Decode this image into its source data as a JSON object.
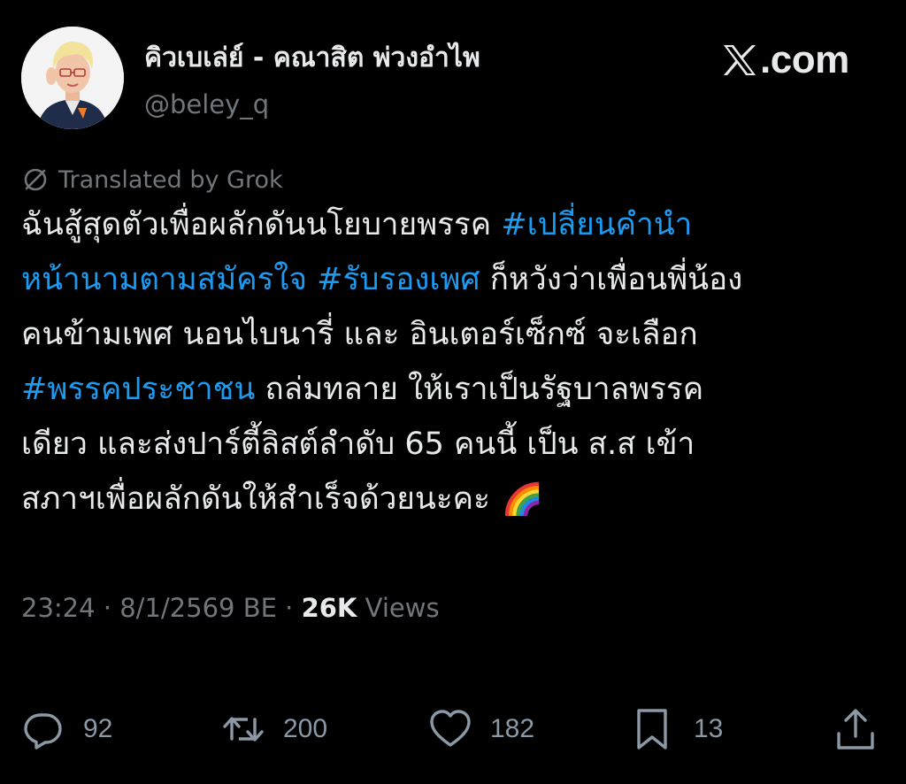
{
  "author": {
    "display_name": "คิวเบเล่ย์ - คณาสิต พ่วงอำไพ",
    "handle": "@beley_q",
    "avatar_icon": "profile-photo"
  },
  "brand": {
    "site": ".com",
    "logo_icon": "x-logo-icon"
  },
  "translation": {
    "label": "Translated by Grok",
    "icon": "translate-icon"
  },
  "tweet": {
    "lines": [
      [
        {
          "text": "ฉันสู้สุดตัวเพื่อผลักดันนโยบายพรรค ",
          "type": "text"
        },
        {
          "text": "#เปลี่ยนคำนำ",
          "type": "hashtag"
        }
      ],
      [
        {
          "text": "หน้านามตามสมัครใจ",
          "type": "hashtag"
        },
        {
          "text": " ",
          "type": "text"
        },
        {
          "text": "#รับรองเพศ",
          "type": "hashtag"
        },
        {
          "text": " ก็หวังว่าเพื่อนพี่น้อง",
          "type": "text"
        }
      ],
      [
        {
          "text": "คนข้ามเพศ  นอนไบนารี่ และ อินเตอร์เซ็กซ์ จะเลือก",
          "type": "text"
        }
      ],
      [
        {
          "text": "#พรรคประชาชน",
          "type": "hashtag"
        },
        {
          "text": " ถล่มทลาย ให้เราเป็นรัฐบาลพรรค",
          "type": "text"
        }
      ],
      [
        {
          "text": "เดียว และส่งปาร์ตี้ลิสต์ลำดับ 65 คนนี้ เป็น ส.ส เข้า",
          "type": "text"
        }
      ],
      [
        {
          "text": "สภาฯเพื่อผลักดันให้สำเร็จด้วยนะคะ ",
          "type": "text"
        },
        {
          "text": "rainbow-emoji",
          "type": "emoji"
        }
      ]
    ]
  },
  "meta": {
    "time": "23:24",
    "separator": " · ",
    "date": "8/1/2569 BE",
    "views_count": "26K",
    "views_label": " Views"
  },
  "actions": {
    "replies": "92",
    "reposts": "200",
    "likes": "182",
    "bookmarks": "13"
  },
  "colors": {
    "background": "#000000",
    "text": "#e7e9ea",
    "secondary": "#71767b",
    "hashtag": "#1d9bf0"
  }
}
